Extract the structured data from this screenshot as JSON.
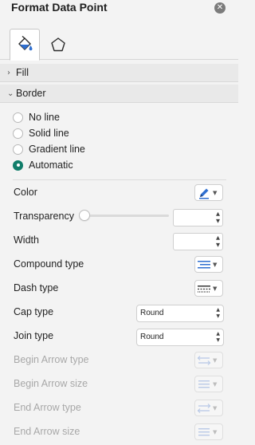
{
  "panel": {
    "title": "Format Data Point",
    "close_icon": "close-icon"
  },
  "tabs": [
    {
      "name": "Fill & Line",
      "icon": "paint-bucket-icon",
      "active": true
    },
    {
      "name": "Effects",
      "icon": "pentagon-icon",
      "active": false
    }
  ],
  "sections": {
    "fill": {
      "label": "Fill",
      "expanded": false
    },
    "border": {
      "label": "Border",
      "expanded": true
    }
  },
  "line_options": [
    {
      "label": "No line",
      "checked": false
    },
    {
      "label": "Solid line",
      "checked": false
    },
    {
      "label": "Gradient line",
      "checked": false
    },
    {
      "label": "Automatic",
      "checked": true
    }
  ],
  "properties": {
    "color": {
      "label": "Color"
    },
    "transparency": {
      "label": "Transparency",
      "value": ""
    },
    "width": {
      "label": "Width",
      "value": ""
    },
    "compound_type": {
      "label": "Compound type"
    },
    "dash_type": {
      "label": "Dash type"
    },
    "cap_type": {
      "label": "Cap type",
      "value": "Round"
    },
    "join_type": {
      "label": "Join type",
      "value": "Round"
    },
    "begin_arrow_type": {
      "label": "Begin Arrow type",
      "enabled": false
    },
    "begin_arrow_size": {
      "label": "Begin Arrow size",
      "enabled": false
    },
    "end_arrow_type": {
      "label": "End Arrow type",
      "enabled": false
    },
    "end_arrow_size": {
      "label": "End Arrow size",
      "enabled": false
    }
  },
  "colors": {
    "accent": "#117d6a",
    "pen_blue": "#2f6fd0",
    "disabled_icon": "#b9c9e6"
  }
}
